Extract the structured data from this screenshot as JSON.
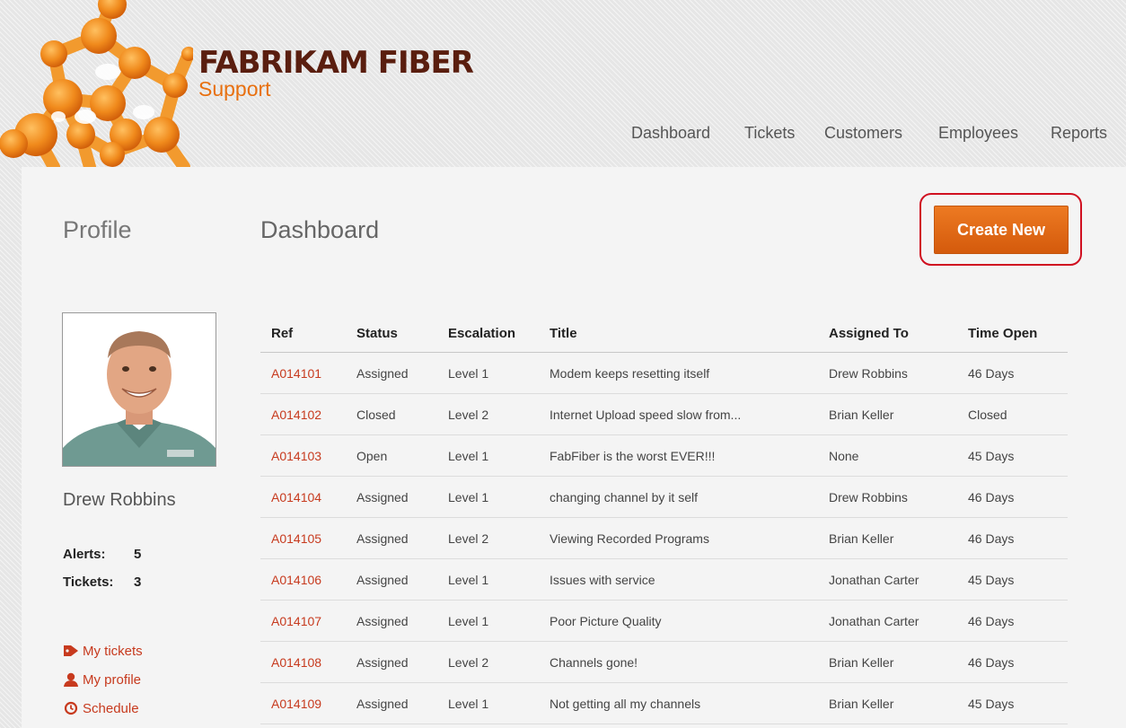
{
  "brand": {
    "title": "FABRIKAM FIBER",
    "subtitle": "Support"
  },
  "nav": [
    "Dashboard",
    "Tickets",
    "Customers",
    "Employees",
    "Reports"
  ],
  "headings": {
    "profile": "Profile",
    "dashboard": "Dashboard"
  },
  "actions": {
    "create_new": "Create New"
  },
  "user": {
    "name": "Drew Robbins",
    "alerts_label": "Alerts:",
    "alerts": "5",
    "tickets_label": "Tickets:",
    "tickets": "3"
  },
  "side_links": [
    {
      "label": "My tickets",
      "icon": "tag-icon"
    },
    {
      "label": "My profile",
      "icon": "person-icon"
    },
    {
      "label": "Schedule",
      "icon": "clock-icon"
    }
  ],
  "table": {
    "columns": [
      "Ref",
      "Status",
      "Escalation",
      "Title",
      "Assigned To",
      "Time Open"
    ],
    "rows": [
      [
        "A014101",
        "Assigned",
        "Level 1",
        "Modem keeps resetting itself",
        "Drew Robbins",
        "46 Days"
      ],
      [
        "A014102",
        "Closed",
        "Level 2",
        "Internet Upload speed slow from...",
        "Brian Keller",
        "Closed"
      ],
      [
        "A014103",
        "Open",
        "Level 1",
        "FabFiber is the worst EVER!!!",
        "None",
        "45 Days"
      ],
      [
        "A014104",
        "Assigned",
        "Level 1",
        "changing channel by it self",
        "Drew Robbins",
        "46 Days"
      ],
      [
        "A014105",
        "Assigned",
        "Level 2",
        "Viewing Recorded Programs",
        "Brian Keller",
        "46 Days"
      ],
      [
        "A014106",
        "Assigned",
        "Level 1",
        "Issues with service",
        "Jonathan Carter",
        "45 Days"
      ],
      [
        "A014107",
        "Assigned",
        "Level 1",
        "Poor Picture Quality",
        "Jonathan Carter",
        "46 Days"
      ],
      [
        "A014108",
        "Assigned",
        "Level 2",
        "Channels gone!",
        "Brian Keller",
        "46 Days"
      ],
      [
        "A014109",
        "Assigned",
        "Level 1",
        "Not getting all my channels",
        "Brian Keller",
        "45 Days"
      ]
    ]
  },
  "colors": {
    "brand_dark": "#5a1e0f",
    "brand_orange": "#e8700f",
    "link": "#c73a1e",
    "button": "#e06a12",
    "highlight": "#d01020"
  }
}
